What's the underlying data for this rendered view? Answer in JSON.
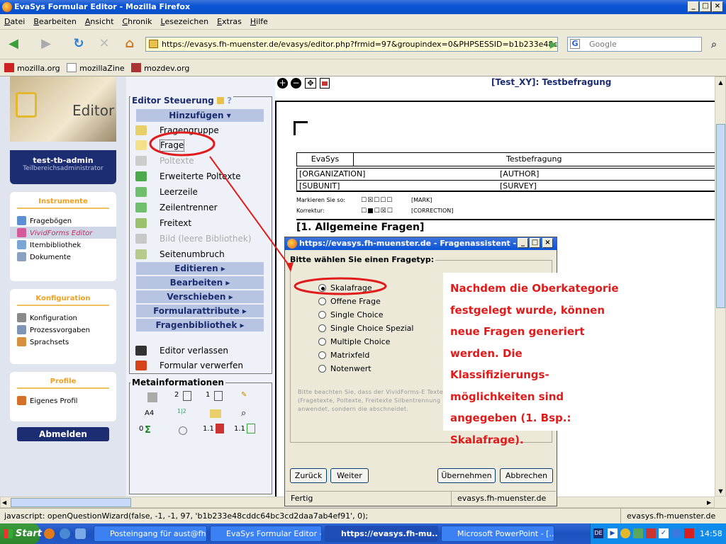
{
  "window": {
    "title": "EvaSys Formular Editor - Mozilla Firefox"
  },
  "menu": [
    "Datei",
    "Bearbeiten",
    "Ansicht",
    "Chronik",
    "Lesezeichen",
    "Extras",
    "Hilfe"
  ],
  "nav": {
    "url": "https://evasys.fh-muenster.de/evasys/editor.php?frmid=97&groupindex=0&PHPSESSID=b1b233e48c",
    "search_placeholder": "Google"
  },
  "bookmarks": [
    "mozilla.org",
    "mozillaZine",
    "mozdev.org"
  ],
  "left": {
    "logo_text": "Editor",
    "user": "test-tb-admin",
    "role": "Teilbereichsadministrator",
    "instrumente": {
      "title": "Instrumente",
      "items": [
        "Fragebögen",
        "VividForms Editor",
        "Itembibliothek",
        "Dokumente"
      ]
    },
    "konfiguration": {
      "title": "Konfiguration",
      "items": [
        "Konfiguration",
        "Prozessvorgaben",
        "Sprachsets"
      ]
    },
    "profile": {
      "title": "Profile",
      "items": [
        "Eigenes Profil"
      ]
    },
    "logout": "Abmelden"
  },
  "editor": {
    "title": "Editor Steuerung",
    "help": "?",
    "hinzufuegen": "Hinzufügen ▾",
    "items": [
      "Fragengruppe",
      "Frage",
      "Poltexte",
      "Erweiterte Poltexte",
      "Leerzeile",
      "Zeilentrenner",
      "Freitext",
      "Bild (leere Bibliothek)",
      "Seitenumbruch"
    ],
    "menus": [
      "Editieren ▸",
      "Bearbeiten ▸",
      "Verschieben ▸",
      "Formularattribute ▸",
      "Fragenbibliothek ▸"
    ],
    "actions": [
      "Editor verlassen",
      "Formular verwerfen"
    ],
    "meta_title": "Metainformationen",
    "meta": [
      "2",
      "1",
      "A4",
      "1|2",
      "0",
      "1.1",
      "1.1"
    ]
  },
  "form": {
    "header": "[Test_XY]: Testbefragung",
    "col1": "EvaSys",
    "col2": "Testbefragung",
    "org": "[ORGANIZATION]",
    "author": "[AUTHOR]",
    "subunit": "[SUBUNIT]",
    "survey": "[SURVEY]",
    "mark_label": "Markieren Sie so:",
    "mark_tag": "[MARK]",
    "corr_label": "Korrektur:",
    "corr_tag": "[CORRECTION]",
    "section": "[1. Allgemeine Fragen]"
  },
  "dialog": {
    "title": "https://evasys.fh-muenster.de - Fragenassistent - ...",
    "group": "Bitte wählen Sie einen Fragetyp:",
    "options": [
      "Skalafrage",
      "Offene Frage",
      "Single Choice",
      "Single Choice Spezial",
      "Multiple Choice",
      "Matrixfeld",
      "Notenwert"
    ],
    "selected": "Skalafrage",
    "note": "Bitte beachten Sie, dass der VividForms-E Texte (Fragetexte, Poltexte, Freitexte Silbentrennung anwendet, sondern die abschneidet.",
    "buttons": [
      "Zurück",
      "Weiter",
      "Übernehmen",
      "Abbrechen"
    ],
    "status": "Fertig",
    "status_host": "evasys.fh-muenster.de"
  },
  "callout": [
    "Nachdem die Oberkategorie",
    "festgelegt wurde, können",
    "neue Fragen generiert",
    "werden. Die Klassifizierungs-",
    "möglichkeiten sind",
    "angegeben (1. Bsp.:",
    "Skalafrage)."
  ],
  "status": {
    "text": "javascript: openQuestionWizard(false, -1, -1, 97, 'b1b233e48cddc64bc3cd2daa7ab4ef91', 0);",
    "host": "evasys.fh-muenster.de"
  },
  "taskbar": {
    "start": "Start",
    "tasks": [
      "Posteingang für aust@fh...",
      "EvaSys Formular Editor -...",
      "https://evasys.fh-mu...",
      "Microsoft PowerPoint - [..."
    ],
    "clock": "14:58",
    "lang": "DE"
  },
  "colors": {
    "accent": "#e01b1b",
    "nav": "#1d2d72"
  }
}
